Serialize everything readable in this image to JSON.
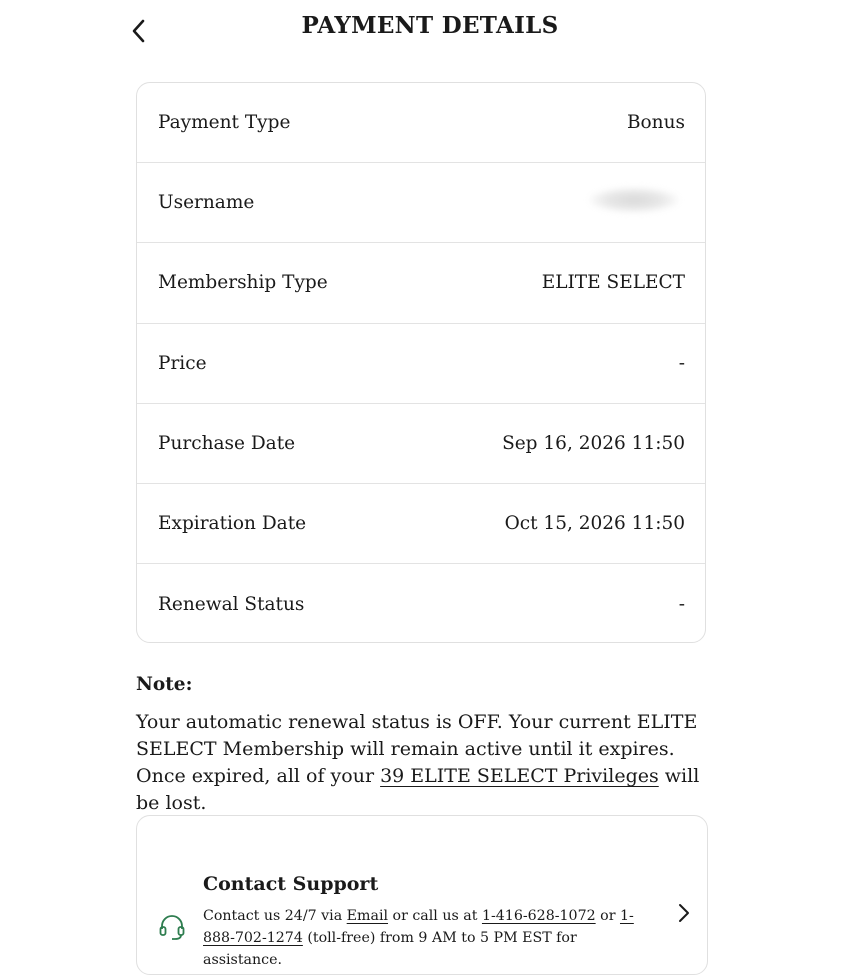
{
  "header": {
    "title": "PAYMENT DETAILS",
    "back_icon": "chevron-left-icon"
  },
  "details": [
    {
      "label": "Payment Type",
      "value": "Bonus"
    },
    {
      "label": "Username",
      "value": ""
    },
    {
      "label": "Membership Type",
      "value": "ELITE SELECT"
    },
    {
      "label": "Price",
      "value": "-"
    },
    {
      "label": "Purchase Date",
      "value": "Sep 16, 2026 11:50"
    },
    {
      "label": "Expiration Date",
      "value": "Oct 15, 2026 11:50"
    },
    {
      "label": "Renewal Status",
      "value": "-"
    }
  ],
  "note": {
    "label": "Note:",
    "text_before": "Your automatic renewal status is OFF. Your current ELITE SELECT Membership will remain active until it expires. Once expired, all of your ",
    "link": "39 ELITE SELECT Privileges",
    "text_after": " will be lost."
  },
  "support": {
    "title": "Contact Support",
    "text_1": "Contact us 24/7 via ",
    "email_link": "Email",
    "text_2": " or call us at ",
    "phone_1": "1-416-628-1072",
    "text_3": " or ",
    "phone_2": "1-888-702-1274",
    "text_4": " (toll-free) from 9 AM to 5 PM EST for assistance.",
    "icon": "headset-icon",
    "icon_color": "#2e7d4f",
    "arrow_icon": "chevron-right-icon"
  }
}
